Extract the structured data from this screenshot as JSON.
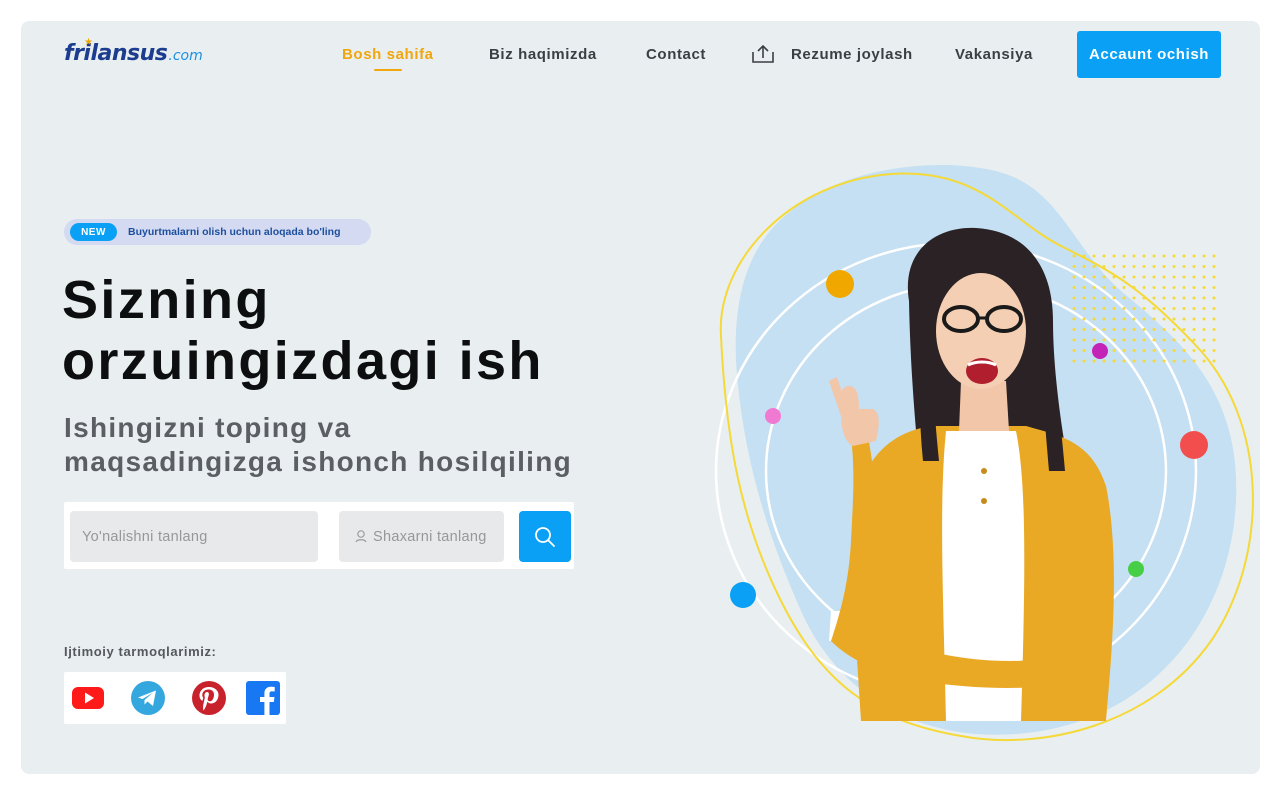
{
  "brand": {
    "logo_main": "frilansus",
    "logo_suffix": ".com"
  },
  "nav": {
    "items": [
      {
        "label": "Bosh sahifa",
        "active": true
      },
      {
        "label": "Biz haqimizda",
        "active": false
      },
      {
        "label": "Contact",
        "active": false
      },
      {
        "label": "Rezume joylash",
        "active": false,
        "icon": "upload-icon"
      },
      {
        "label": "Vakansiya",
        "active": false
      }
    ],
    "cta_label": "Accaunt ochish"
  },
  "hero": {
    "badge_tag": "NEW",
    "badge_text": "Buyurtmalarni olish uchun aloqada bo'ling",
    "headline_line1": "Sizning",
    "headline_line2": "orzuingizdagi ish",
    "subline_line1": "Ishingizni toping va",
    "subline_line2": "maqsadingizga ishonch hosilqiling"
  },
  "search": {
    "direction_placeholder": "Yo'nalishni tanlang",
    "city_placeholder": "Shaxarni tanlang",
    "button_icon": "search-icon"
  },
  "social": {
    "label": "Ijtimoiy tarmoqlarimiz:",
    "items": [
      "youtube-icon",
      "telegram-icon",
      "pinterest-icon",
      "facebook-icon"
    ]
  },
  "colors": {
    "accent": "#0aa0f6",
    "active_nav": "#f0a60c",
    "background": "#e9eff1",
    "blob": "#c5e0f2",
    "sweater": "#e9a925"
  }
}
